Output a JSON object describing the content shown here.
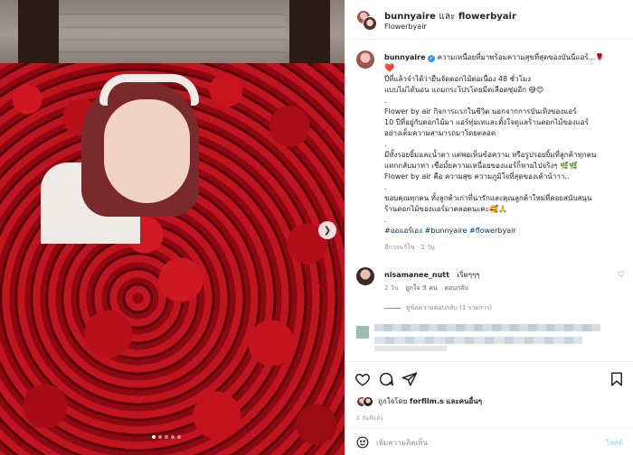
{
  "header": {
    "user1": "bunnyaire",
    "and": "และ",
    "user2": "flowerbyair",
    "subtitle": "Flowerbyair"
  },
  "caption": {
    "user": "bunnyaire",
    "line1": "ความเหนื่อยที่มาพร้อมความสุขที่สุดของบันนี่แอร์...🌹",
    "heart": "❤️",
    "p1_l1": "ปีที่แล้วจำได้ว่ายืนจัดดอกไม้ต่อเนื่อง 48 ชั่วโมง",
    "p1_l2": "แบบไม่ได้นอน แถมกระโปรโดยมีดเลือดซุ่มอีก 😅😊",
    "dot": ".",
    "p2_l1": "Flower by air กิจการแรกในชีวิต นอกจากการบันเทิงของแอร์",
    "p2_l2": "10 ปีที่อยู่กับดอกไม้มา แอร์ทุ่มเทและตั้งใจดูแลร้านดอกไม้ของแอร์",
    "p2_l3": "อย่างเต็มความสามารถมาโดยตลอด",
    "p3_l1": "มีทั้งรอยยิ้มและน้ำตา แต่พอเห็นข้อความ หรือรูปรอยยิ้มที่ลูกค้าทุกคน",
    "p3_l2": "แทกกลับมาหา เชื่อมั้ยความเหนื่อยของแอร์ก็หายไปจริงๆ 🌿🌿",
    "p3_l3": "Flower by air คือ ความสุข ความภูมิใจที่สุดของเค้าน้าาา..",
    "p4_l1": "ขอบคุณทุกคน ทั้งลูกค้าเก่าที่น่ารักและคุณลูกค้าใหม่ที่คอยสนับสนุน",
    "p4_l2": "ร้านดอกไม้ของแอร์มาตลอดนะคะ🥰🙏",
    "tags": "#ออแอร์เอง #bunnyaire #flowerbyair",
    "edited": "มีการแก้ไข · 2 วัน"
  },
  "comment": {
    "user": "nisamanee_nutt",
    "text": "เริ่ดๆๆๆ",
    "time": "2 วัน",
    "likes": "ถูกใจ 3 คน",
    "reply": "ตอบกลับ",
    "view_replies": "ดูข้อความตอบกลับ (1 รายการ)"
  },
  "likes": {
    "prefix": "ถูกใจโดย",
    "user": "forfilm.s",
    "suffix": "และคนอื่นๆ"
  },
  "date": "2 วันที่แล้ว",
  "add_comment": {
    "placeholder": "เพิ่มความคิดเห็น",
    "post": "โพสต์"
  },
  "icons": {
    "like": "heart-icon",
    "comment": "comment-icon",
    "share": "share-icon",
    "save": "bookmark-icon",
    "emoji": "emoji-icon",
    "next": "chevron-right-icon",
    "verified": "verified-badge-icon"
  }
}
